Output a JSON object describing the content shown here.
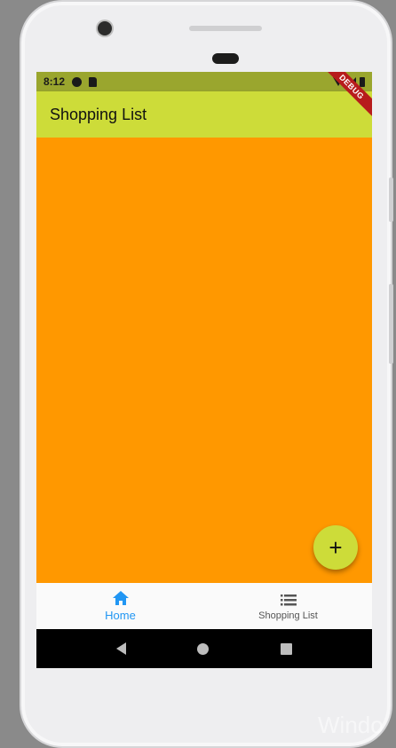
{
  "status_bar": {
    "time": "8:12"
  },
  "debug_banner": {
    "label": "DEBUG"
  },
  "app_bar": {
    "title": "Shopping List"
  },
  "fab": {
    "label": "+"
  },
  "bottom_nav": {
    "items": [
      {
        "label": "Home",
        "icon": "home-icon",
        "active": true
      },
      {
        "label": "Shopping List",
        "icon": "list-icon",
        "active": false
      }
    ]
  },
  "watermark": {
    "text": "Windo"
  },
  "colors": {
    "app_bar": "#cddc39",
    "body": "#ff9800",
    "active_nav": "#2196f3",
    "status_bar": "#9aa62e"
  }
}
